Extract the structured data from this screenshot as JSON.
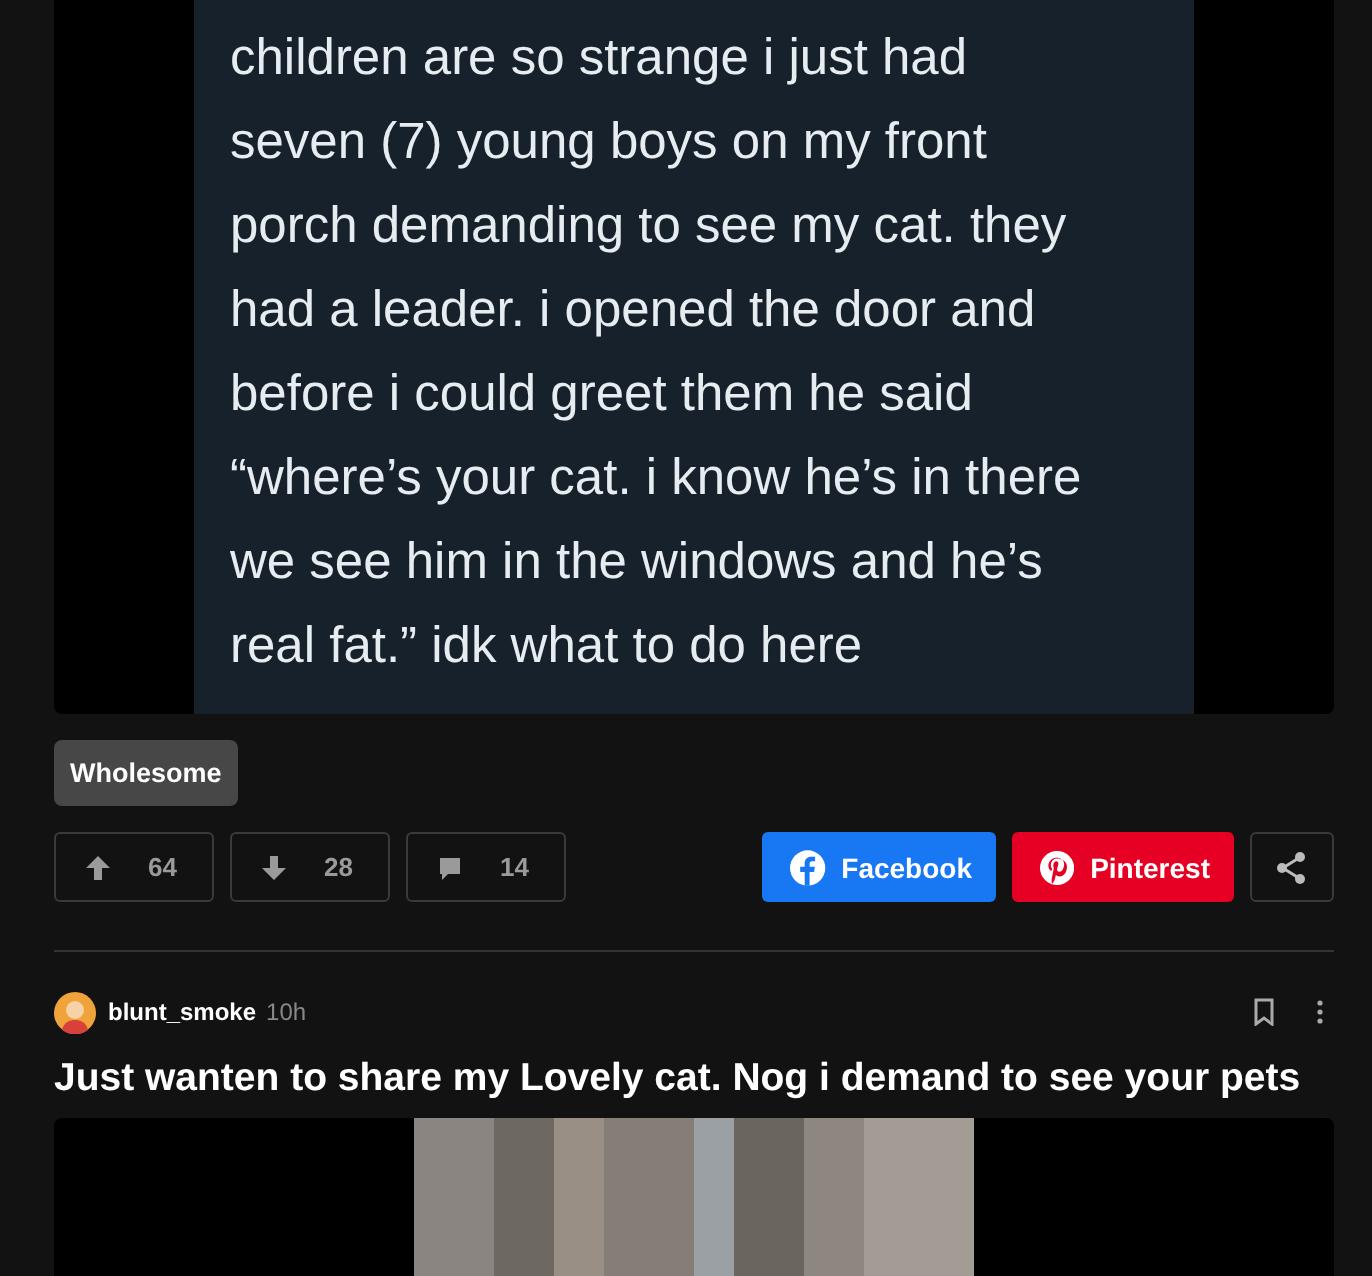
{
  "post": {
    "image": {
      "kind": "tweet",
      "lines": [
        "children are so strange i just had",
        "seven (7) young boys on my front",
        "porch demanding to see my cat. they",
        "had a leader. i opened the door and",
        "before i could greet them he said",
        "“where’s your cat. i know he’s in there",
        "we see him in the windows and he’s",
        "real fat.” idk what to do here"
      ]
    },
    "tags": [
      "Wholesome"
    ],
    "actions": [
      {
        "kind": "upvote",
        "count": "64"
      },
      {
        "kind": "downvote",
        "count": "28"
      },
      {
        "kind": "comment",
        "count": "14"
      }
    ],
    "share": [
      {
        "kind": "facebook",
        "label": "Facebook"
      },
      {
        "kind": "pinterest",
        "label": "Pinterest"
      },
      {
        "kind": "share"
      }
    ]
  },
  "next_post": {
    "author": "blunt_smoke",
    "time": "10h",
    "title": "Just wanten to share my Lovely cat. Nog i demand to see your pets"
  }
}
